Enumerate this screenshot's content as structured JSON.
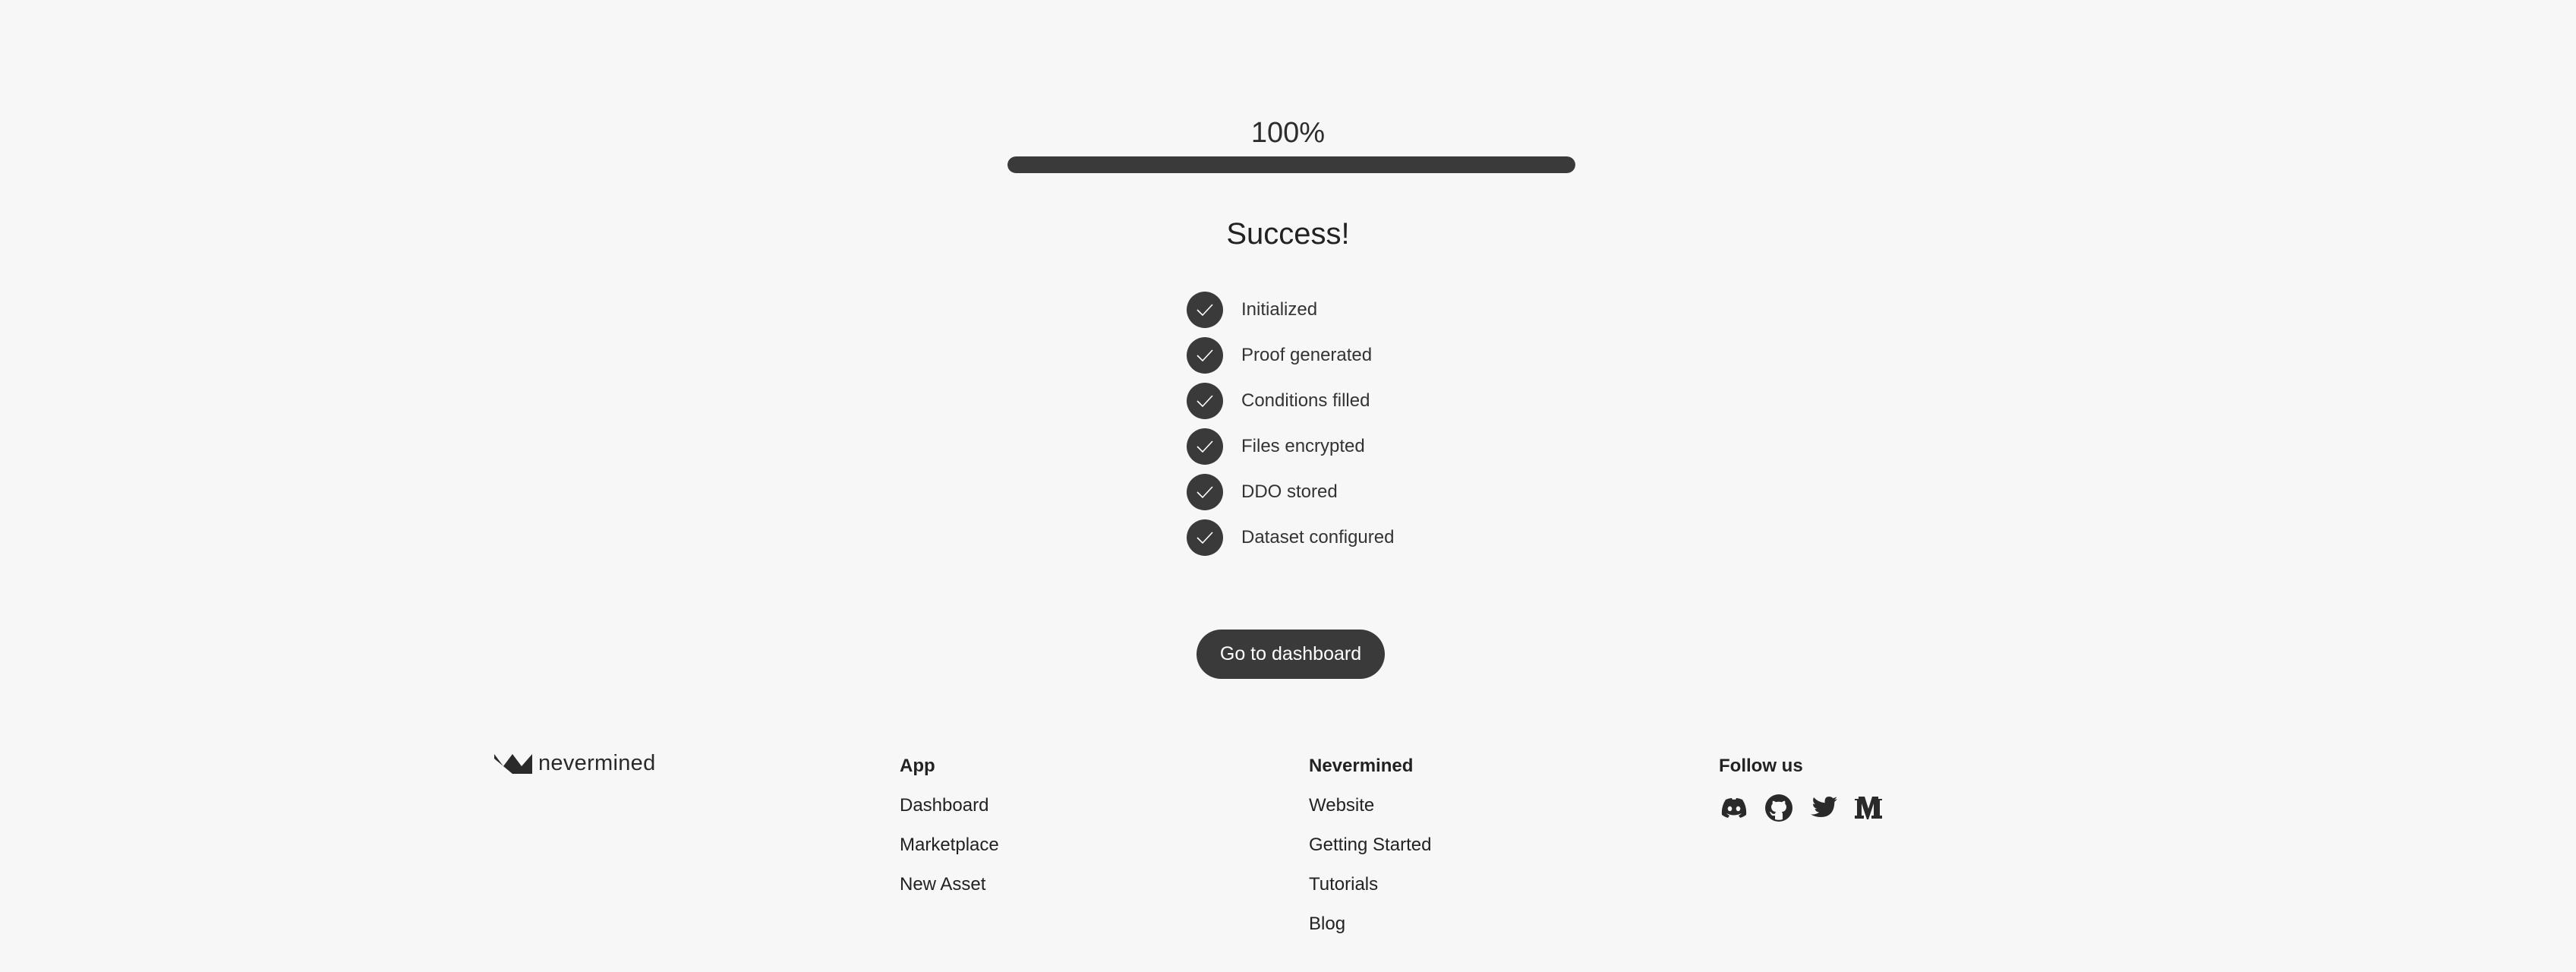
{
  "progress": {
    "percent_label": "100%",
    "value": 1.0,
    "fill_color": "#3a3a3a"
  },
  "status": {
    "title": "Success!"
  },
  "steps": [
    {
      "label": "Initialized",
      "icon": "check-icon"
    },
    {
      "label": "Proof generated",
      "icon": "check-icon"
    },
    {
      "label": "Conditions filled",
      "icon": "check-icon"
    },
    {
      "label": "Files encrypted",
      "icon": "check-icon"
    },
    {
      "label": "DDO stored",
      "icon": "check-icon"
    },
    {
      "label": "Dataset configured",
      "icon": "check-icon"
    }
  ],
  "actions": {
    "dashboard_label": "Go to dashboard"
  },
  "footer": {
    "logo_text": "nevermined",
    "app": {
      "heading": "App",
      "links": [
        "Dashboard",
        "Marketplace",
        "New Asset"
      ]
    },
    "nevermined": {
      "heading": "Nevermined",
      "links": [
        "Website",
        "Getting Started",
        "Tutorials",
        "Blog"
      ]
    },
    "follow": {
      "heading": "Follow us",
      "icons": [
        "discord-icon",
        "github-icon",
        "twitter-icon",
        "medium-icon"
      ]
    }
  },
  "colors": {
    "background": "#f7f7f7",
    "accent": "#3a3a3a"
  }
}
